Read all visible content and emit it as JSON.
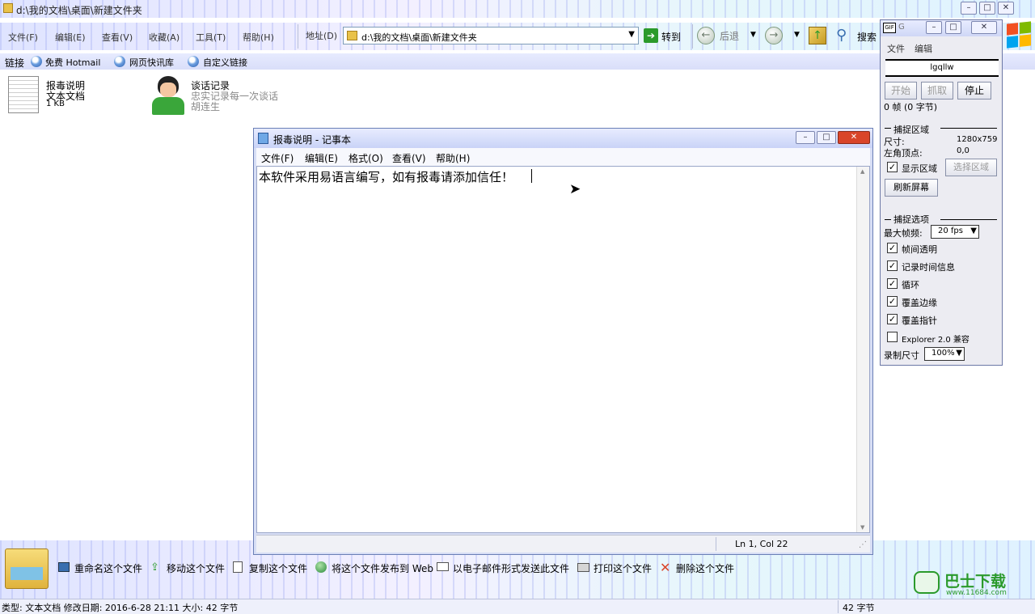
{
  "explorer": {
    "title": "d:\\我的文档\\桌面\\新建文件夹",
    "menu": [
      "文件(F)",
      "编辑(E)",
      "查看(V)",
      "收藏(A)",
      "工具(T)",
      "帮助(H)"
    ],
    "address_label": "地址(D)",
    "address_value": "d:\\我的文档\\桌面\\新建文件夹",
    "go_label": "转到",
    "back_label": "后退",
    "search_label": "搜索",
    "links_label": "链接",
    "links": [
      "免费 Hotmail",
      "网页快讯库",
      "自定义链接"
    ],
    "files": [
      {
        "name": "报毒说明",
        "line2": "文本文档",
        "line3": "1 KB",
        "icon": "text-document-icon"
      },
      {
        "name": "谈话记录",
        "line2": "忠实记录每一次谈话",
        "line3": "胡连生",
        "icon": "user-avatar-icon"
      }
    ],
    "tasks": [
      "重命名这个文件",
      "移动这个文件",
      "复制这个文件",
      "将这个文件发布到 Web",
      "以电子邮件形式发送此文件",
      "打印这个文件",
      "删除这个文件"
    ],
    "status_left": "类型: 文本文档 修改日期: 2016-6-28 21:11 大小: 42 字节",
    "status_right": "42 字节"
  },
  "notepad": {
    "title": "报毒说明 - 记事本",
    "menu": [
      "文件(F)",
      "编辑(E)",
      "格式(O)",
      "查看(V)",
      "帮助(H)"
    ],
    "content": "本软件采用易语言编写，如有报毒请添加信任！",
    "status": "Ln 1, Col 22"
  },
  "capture": {
    "title": "G",
    "menu": [
      "文件",
      "编辑"
    ],
    "name": "lgqllw",
    "buttons": [
      "开始",
      "抓取",
      "停止"
    ],
    "frames": "0 帧 (0 字节)",
    "area_header": "捕捉区域",
    "size_label": "尺寸:",
    "size_value": "1280x759",
    "corner_label": "左角顶点:",
    "corner_value": "0,0",
    "show_area": "显示区域",
    "select_area": "选择区域",
    "refresh": "刷新屏幕",
    "options_header": "捕捉选项",
    "max_fps_label": "最大帧频:",
    "max_fps_value": "20 fps",
    "options": [
      {
        "label": "帧间透明",
        "checked": true
      },
      {
        "label": "记录时间信息",
        "checked": true
      },
      {
        "label": "循环",
        "checked": true
      },
      {
        "label": "覆盖边缘",
        "checked": true
      },
      {
        "label": "覆盖指针",
        "checked": true
      },
      {
        "label": "Explorer 2.0 兼容",
        "checked": false
      }
    ],
    "rec_size_label": "录制尺寸",
    "rec_size_value": "100%"
  },
  "watermark": {
    "brand": "巴士下载",
    "url": "www.11684.com"
  },
  "colors": {
    "accent_green": "#2b9a2b",
    "close_red": "#d9452a",
    "windows_logo": [
      "#f25022",
      "#7fba00",
      "#00a4ef",
      "#ffb900"
    ]
  }
}
